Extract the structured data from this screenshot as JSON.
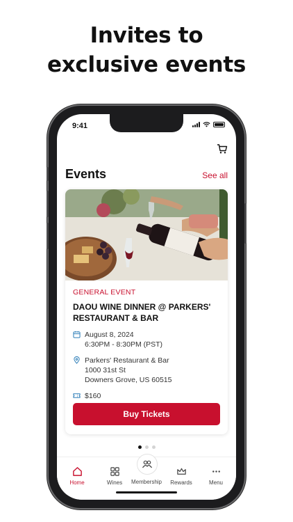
{
  "headline": {
    "line1": "Invites to",
    "line2": "exclusive events"
  },
  "status_bar": {
    "time": "9:41"
  },
  "events": {
    "title": "Events",
    "see_all": "See all",
    "card": {
      "category": "GENERAL EVENT",
      "title": "DAOU WINE DINNER @ PARKERS' RESTAURANT & BAR",
      "date": "August 8, 2024",
      "time": "6:30PM - 8:30PM (PST)",
      "venue": "Parkers' Restaurant & Bar",
      "address1": "1000 31st St",
      "address2": "Downers Grove, US 60515",
      "price": "$160",
      "buy_label": "Buy Tickets"
    },
    "pagination": {
      "current": 1,
      "total": 3
    }
  },
  "tabbar": {
    "items": [
      {
        "label": "Home",
        "icon": "home-icon",
        "active": true
      },
      {
        "label": "Wines",
        "icon": "grid-icon",
        "active": false
      },
      {
        "label": "Membership",
        "icon": "people-icon",
        "active": false
      },
      {
        "label": "Rewards",
        "icon": "crown-icon",
        "active": false
      },
      {
        "label": "Menu",
        "icon": "more-icon",
        "active": false
      }
    ]
  },
  "colors": {
    "accent": "#c8102e",
    "text": "#111111"
  }
}
